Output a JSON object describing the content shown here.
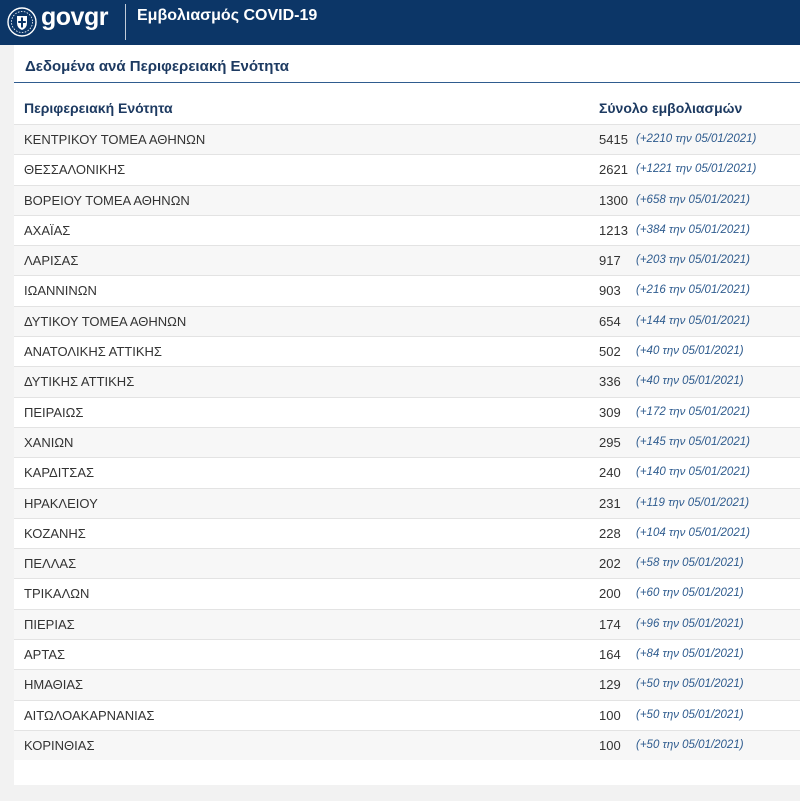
{
  "header": {
    "logo_gov": "gov",
    "logo_gr": "gr",
    "title": "Εμβολιασμός COVID-19"
  },
  "section": {
    "title": "Δεδομένα ανά Περιφερειακή Ενότητα"
  },
  "table": {
    "columns": {
      "region": "Περιφερειακή Ενότητα",
      "total": "Σύνολο εμβολιασμών"
    },
    "rows": [
      {
        "region": "ΚΕΝΤΡΙΚΟΥ ΤΟΜΕΑ ΑΘΗΝΩΝ",
        "total": "5415",
        "delta": "(+2210 την 05/01/2021)"
      },
      {
        "region": "ΘΕΣΣΑΛΟΝΙΚΗΣ",
        "total": "2621",
        "delta": "(+1221 την 05/01/2021)"
      },
      {
        "region": "ΒΟΡΕΙΟΥ ΤΟΜΕΑ ΑΘΗΝΩΝ",
        "total": "1300",
        "delta": "(+658 την 05/01/2021)"
      },
      {
        "region": "ΑΧΑΪΑΣ",
        "total": "1213",
        "delta": "(+384 την 05/01/2021)"
      },
      {
        "region": "ΛΑΡΙΣΑΣ",
        "total": "917",
        "delta": "(+203 την 05/01/2021)"
      },
      {
        "region": "ΙΩΑΝΝΙΝΩΝ",
        "total": "903",
        "delta": "(+216 την 05/01/2021)"
      },
      {
        "region": "ΔΥΤΙΚΟΥ ΤΟΜΕΑ ΑΘΗΝΩΝ",
        "total": "654",
        "delta": "(+144 την 05/01/2021)"
      },
      {
        "region": "ΑΝΑΤΟΛΙΚΗΣ ΑΤΤΙΚΗΣ",
        "total": "502",
        "delta": "(+40 την 05/01/2021)"
      },
      {
        "region": "ΔΥΤΙΚΗΣ ΑΤΤΙΚΗΣ",
        "total": "336",
        "delta": "(+40 την 05/01/2021)"
      },
      {
        "region": "ΠΕΙΡΑΙΩΣ",
        "total": "309",
        "delta": "(+172 την 05/01/2021)"
      },
      {
        "region": "ΧΑΝΙΩΝ",
        "total": "295",
        "delta": "(+145 την 05/01/2021)"
      },
      {
        "region": "ΚΑΡΔΙΤΣΑΣ",
        "total": "240",
        "delta": "(+140 την 05/01/2021)"
      },
      {
        "region": "ΗΡΑΚΛΕΙΟΥ",
        "total": "231",
        "delta": "(+119 την 05/01/2021)"
      },
      {
        "region": "ΚΟΖΑΝΗΣ",
        "total": "228",
        "delta": "(+104 την 05/01/2021)"
      },
      {
        "region": "ΠΕΛΛΑΣ",
        "total": "202",
        "delta": "(+58 την 05/01/2021)"
      },
      {
        "region": "ΤΡΙΚΑΛΩΝ",
        "total": "200",
        "delta": "(+60 την 05/01/2021)"
      },
      {
        "region": "ΠΙΕΡΙΑΣ",
        "total": "174",
        "delta": "(+96 την 05/01/2021)"
      },
      {
        "region": "ΑΡΤΑΣ",
        "total": "164",
        "delta": "(+84 την 05/01/2021)"
      },
      {
        "region": "ΗΜΑΘΙΑΣ",
        "total": "129",
        "delta": "(+50 την 05/01/2021)"
      },
      {
        "region": "ΑΙΤΩΛΟΑΚΑΡΝΑΝΙΑΣ",
        "total": "100",
        "delta": "(+50 την 05/01/2021)"
      },
      {
        "region": "ΚΟΡΙΝΘΙΑΣ",
        "total": "100",
        "delta": "(+50 την 05/01/2021)"
      }
    ]
  },
  "icons": {
    "emblem": "hellenic-republic-emblem-icon"
  },
  "colors": {
    "header_bg": "#0c3667",
    "accent": "#2f5c8f",
    "heading_text": "#1d3a61",
    "page_bg": "#f2f2f2"
  }
}
